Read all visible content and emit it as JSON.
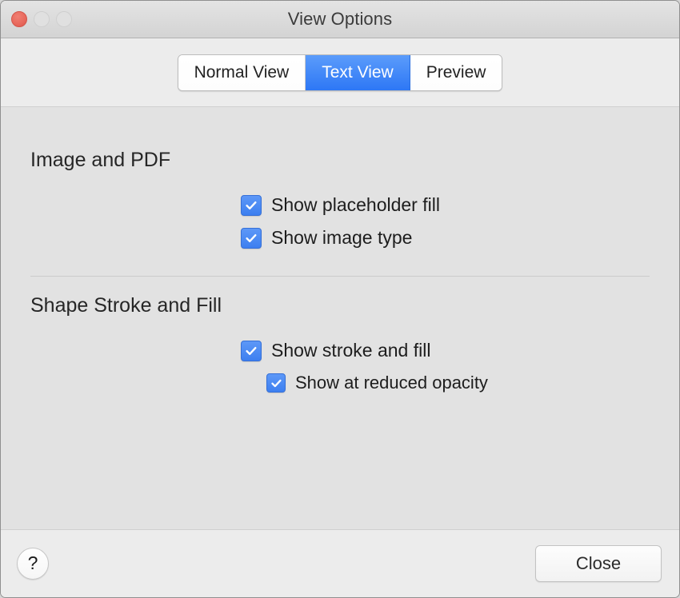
{
  "window": {
    "title": "View Options",
    "traffic_lights": [
      {
        "name": "close",
        "state": "active",
        "color": "#e8685c"
      },
      {
        "name": "minimize",
        "state": "disabled",
        "color": "#e0e0e0"
      },
      {
        "name": "zoom",
        "state": "disabled",
        "color": "#e0e0e0"
      }
    ]
  },
  "tabs": {
    "selected": "Text View",
    "selected_color": "#2d77f5",
    "items": [
      {
        "label": "Normal View",
        "selected": false
      },
      {
        "label": "Text View",
        "selected": true
      },
      {
        "label": "Preview",
        "selected": false
      }
    ]
  },
  "sections": [
    {
      "title": "Image and PDF",
      "options": [
        {
          "label": "Show placeholder fill",
          "checked": true,
          "indent": 1
        },
        {
          "label": "Show image type",
          "checked": true,
          "indent": 1
        }
      ]
    },
    {
      "title": "Shape Stroke and Fill",
      "options": [
        {
          "label": "Show stroke and fill",
          "checked": true,
          "indent": 1
        },
        {
          "label": "Show at reduced opacity",
          "checked": true,
          "indent": 2
        }
      ]
    }
  ],
  "footer": {
    "help_label": "?",
    "close_label": "Close"
  },
  "colors": {
    "checkbox_blue": "#3d7ff0",
    "content_bg": "#e2e2e2",
    "chrome_bg": "#ececec"
  }
}
